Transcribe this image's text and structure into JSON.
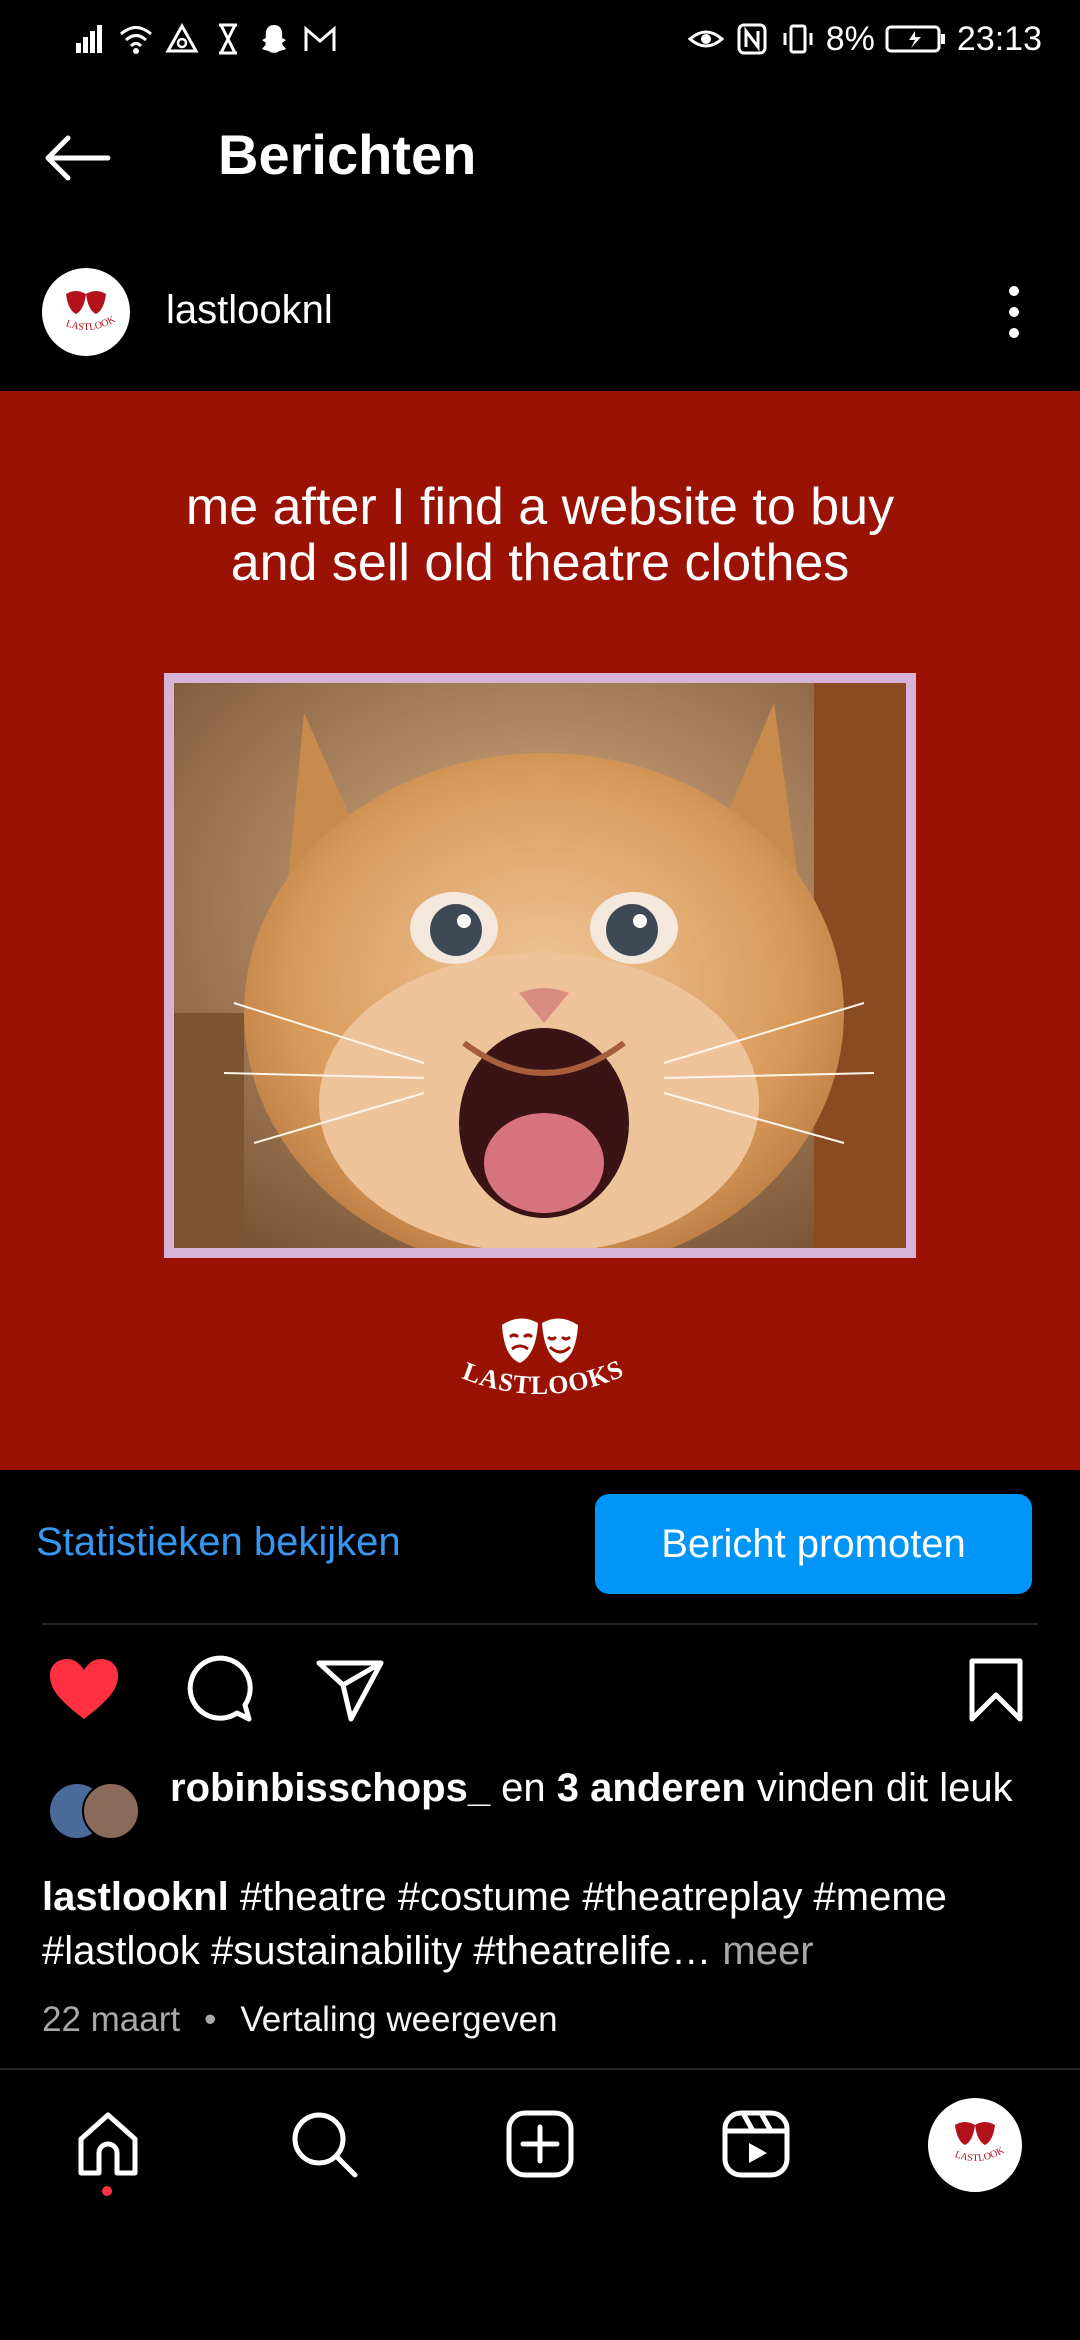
{
  "status_bar": {
    "battery": "8%",
    "time": "23:13",
    "left_icons": [
      "signal-icon",
      "wifi-icon",
      "hotspot-icon",
      "hourglass-icon",
      "snapchat-icon",
      "gmail-icon"
    ],
    "right_icons": [
      "eye-icon",
      "nfc-icon",
      "vibrate-icon",
      "battery-icon"
    ]
  },
  "header": {
    "title": "Berichten"
  },
  "post": {
    "username": "lastlooknl",
    "meme_caption_line1": "me after I find a website to buy",
    "meme_caption_line2": "and sell old theatre clothes",
    "logo_text": "LASTLOOKS",
    "background_color": "#9a1204"
  },
  "actions": {
    "stats_label": "Statistieken bekijken",
    "promote_label": "Bericht promoten"
  },
  "likes": {
    "user": "robinbisschops_",
    "connector": " en ",
    "others": "3 anderen",
    "suffix": " vinden dit leuk"
  },
  "caption": {
    "user": "lastlooknl",
    "text": " #theatre #costume #theatreplay #meme #lastlook #sustainability #theatrelife…",
    "more": " meer"
  },
  "date": "22 maart",
  "separator": "•",
  "translate_label": "Vertaling weergeven",
  "nav": [
    "home-icon",
    "search-icon",
    "create-icon",
    "reels-icon",
    "profile-avatar"
  ]
}
